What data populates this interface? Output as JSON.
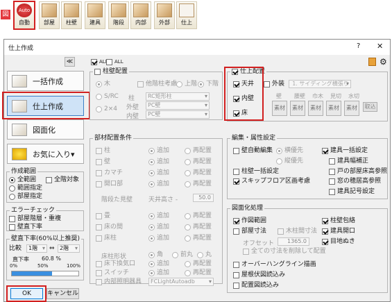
{
  "toolbar": {
    "zu": "図",
    "items": [
      "自動",
      "部屋",
      "柱壁",
      "建具",
      "階段",
      "内部",
      "外部",
      "仕上"
    ],
    "auto_badge": "Auto"
  },
  "dialog": {
    "title": "仕上作成",
    "help": "?",
    "close": "✕"
  },
  "left": {
    "collapse": "≪",
    "ikkatsu": "一括作成",
    "shiage": "仕上作成",
    "zumenka": "図面化",
    "okiniiri": "お気に入り▾",
    "range": {
      "title": "作成範囲",
      "all": "全範囲",
      "all_target": "全階対象",
      "range": "範囲指定",
      "room": "部屋指定"
    },
    "error": {
      "title": "エラーチェック",
      "item1": "部屋階層・重複",
      "item2": "壁直下率"
    },
    "ratio": {
      "title": "壁直下率(60%以上推奨)",
      "compare": "比較",
      "f1": "1階",
      "arrow": "⇔",
      "f2": "2階",
      "rate_label": "直下率",
      "rate": "60.8 %",
      "value": 0.608,
      "ticks": [
        "0%",
        "50%",
        "100%"
      ]
    },
    "ok": "OK",
    "cancel": "キャンセル"
  },
  "tabs": {
    "t1": "ALL",
    "t2": "ALL"
  },
  "pillar": {
    "title": "柱壁配置",
    "wood": "木",
    "wall_consider": "他階柱考慮",
    "up": "上階",
    "down": "下階",
    "src": "S/RC",
    "col": "柱",
    "col_val": "RC矩形柱",
    "x24": "2×4",
    "ext": "外壁",
    "ext_val": "PC壁",
    "int": "内壁",
    "int_val": "PC壁"
  },
  "parts": {
    "title": "部材配置条件",
    "add": "追加",
    "re": "再配置",
    "g1": [
      "柱",
      "壁",
      "カマチ",
      "開口部"
    ],
    "stair_h": "階段た見壁",
    "ceil_h": "天井高さ -",
    "ceil_val": "50.0",
    "g2": [
      "畳",
      "床の間",
      "床柱"
    ],
    "floor_pillar_shape": "床柱形状",
    "kaku": "角",
    "maemaru": "前丸",
    "maru": "丸",
    "g3": [
      "床下換気口",
      "スイッチ"
    ],
    "light": "内部照明器具",
    "light_val": "FCLightAutoadb"
  },
  "finish": {
    "title": "仕上配置",
    "ceiling": "天井",
    "inwall": "内壁",
    "floor": "床",
    "outwall": "外装",
    "siding": "1. サイディング横張り",
    "cols": [
      "壁",
      "腰壁",
      "巾木",
      "見切",
      "水切"
    ],
    "btn": "素材",
    "remove": "取込"
  },
  "edit": {
    "title": "編集・属性設定",
    "auto_wall": "壁自動編集",
    "yoko": "横優先",
    "tate": "縦優先",
    "pillar_wall": "柱壁一括設定",
    "skip": "スキップフロア区画考慮",
    "tategu_all": "建具一括設定",
    "tategu_w": "建具幅補正",
    "door_ceil": "戸の部屋床高参照",
    "window_base": "窓の穂居高参照",
    "tategu_code": "建具記号設定"
  },
  "drawing": {
    "title": "図面化処理",
    "sakuzu": "作図範囲",
    "room_dim": "部屋寸法",
    "wood_col": "木柱間寸法",
    "offset": "オフセット",
    "offset_val": "1365.0",
    "del_all": "全ての寸法を削除して配置",
    "overhang": "オーバーハングライン描画",
    "roof": "屋根伏図読込み",
    "layout": "配置図読込み",
    "col_wrap": "柱壁包絡",
    "tategu_open": "建具開口",
    "meji": "目地ぬき"
  }
}
